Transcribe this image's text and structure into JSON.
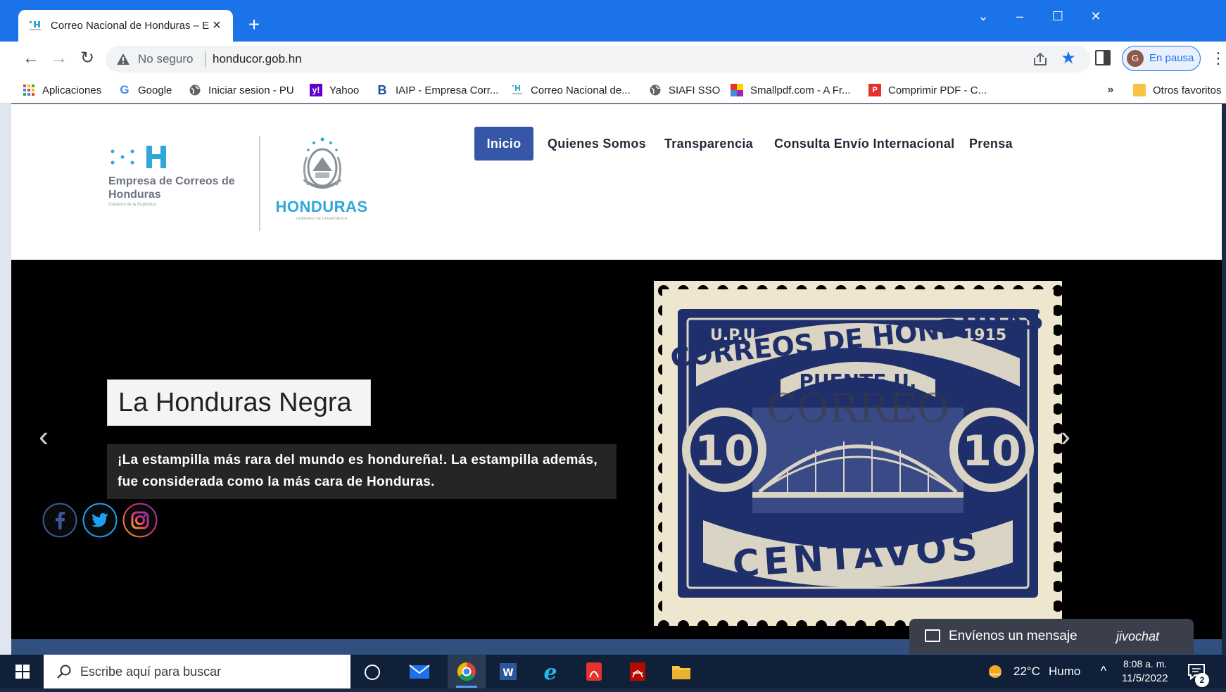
{
  "browser": {
    "tab_title": "Correo Nacional de Honduras – E",
    "tab_close_icon": "×",
    "new_tab_icon": "+",
    "window_controls": [
      "⌄",
      "–",
      "☐",
      "✕"
    ],
    "back_icon": "←",
    "forward_icon": "→",
    "reload_icon": "↻",
    "security_label": "No seguro",
    "url": "honducor.gob.hn",
    "star_icon": "★",
    "profile_initial": "G",
    "profile_status": "En pausa",
    "menu_icon": "⋮",
    "bookmarks": [
      {
        "label": "Aplicaciones",
        "icon": "apps-grid-icon"
      },
      {
        "label": "Google",
        "icon": "google-icon"
      },
      {
        "label": "Iniciar sesion - PU",
        "icon": "globe-icon"
      },
      {
        "label": "Yahoo",
        "icon": "yahoo-icon"
      },
      {
        "label": "IAIP - Empresa Corr...",
        "icon": "iaip-icon"
      },
      {
        "label": "Correo Nacional de...",
        "icon": "honducor-icon"
      },
      {
        "label": "SIAFI SSO",
        "icon": "globe-icon"
      },
      {
        "label": "Smallpdf.com - A Fr...",
        "icon": "smallpdf-icon"
      },
      {
        "label": "Comprimir PDF - C...",
        "icon": "ilovepdf-icon"
      }
    ],
    "bookmarks_more": "»",
    "other_bookmarks": "Otros favoritos"
  },
  "site": {
    "logo_name": "Empresa de Correos de Honduras",
    "logo_sub": "Gobierno de la República",
    "honduras_name": "HONDURAS",
    "honduras_sub": "GOBIERNO DE LA REPÚBLICA",
    "nav": [
      "Inicio",
      "Quienes Somos",
      "Transparencia",
      "Consulta Envío Internacional",
      "Prensa"
    ],
    "hero": {
      "title": "La Honduras Negra",
      "description": "¡La estampilla más rara del mundo es hondureña!. La estampilla además, fue considerada como la más cara de Honduras.",
      "prev_icon": "‹",
      "next_icon": "›"
    },
    "stamp": {
      "top_left": "U.P.U",
      "year": "1915",
      "arc": "CORREOS DE HONDURAS",
      "bridge": "PUENTE U.",
      "value": "10",
      "bottom": "CENTAVOS",
      "overprint": "CORREO"
    },
    "chat": {
      "label": "Envíenos un mensaje",
      "brand": "jivochat"
    }
  },
  "taskbar": {
    "search_placeholder": "Escribe aquí para buscar",
    "temperature": "22°C",
    "condition": "Humo",
    "tray_icon": "^",
    "time": "8:08 a. m.",
    "date": "11/5/2022",
    "notifications": "2"
  },
  "colors": {
    "chrome_blue": "#1a73e8",
    "nav_active": "#3657a7",
    "taskbar": "#0f2038",
    "stamp_ink": "#1f2f6b"
  }
}
